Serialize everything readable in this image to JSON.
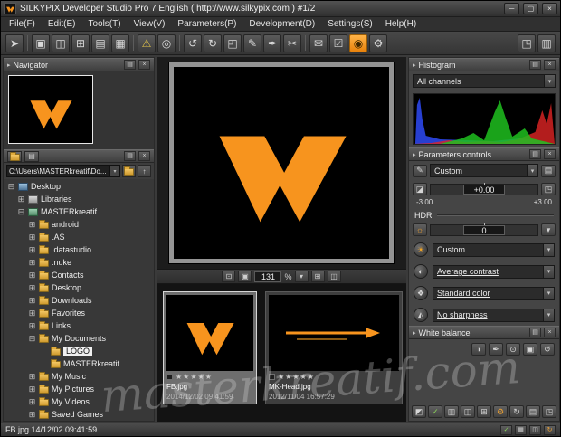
{
  "window": {
    "title": "SILKYPIX Developer Studio Pro 7 English ( http://www.silkypix.com )   #1/2",
    "minimize_glyph": "─",
    "maximize_glyph": "▢",
    "close_glyph": "×"
  },
  "ui": {
    "chevron_down": "▾"
  },
  "panel": {
    "arrow": "▸",
    "menu_glyph": "▤",
    "close_glyph": "×"
  },
  "menubar": {
    "items": [
      "File(F)",
      "Edit(E)",
      "Tools(T)",
      "View(V)",
      "Parameters(P)",
      "Development(D)",
      "Settings(S)",
      "Help(H)"
    ]
  },
  "toolbar": {
    "icons": [
      {
        "name": "select-arrow-icon",
        "glyph": "➤"
      },
      {
        "name": "single-preview-icon",
        "glyph": "▣"
      },
      {
        "name": "two-up-view-icon",
        "glyph": "◫"
      },
      {
        "name": "quad-view-icon",
        "glyph": "⊞"
      },
      {
        "name": "thumbnail-view-icon",
        "glyph": "▤"
      },
      {
        "name": "grid-view-icon",
        "glyph": "▦"
      },
      {
        "name": "warning-display-icon",
        "glyph": "⚠"
      },
      {
        "name": "loupe-icon",
        "glyph": "◎"
      },
      {
        "name": "rotate-left-icon",
        "glyph": "↺"
      },
      {
        "name": "rotate-right-icon",
        "glyph": "↻"
      },
      {
        "name": "crop-icon",
        "glyph": "◰"
      },
      {
        "name": "retouch-pen-icon",
        "glyph": "✎"
      },
      {
        "name": "dropper-icon",
        "glyph": "✒"
      },
      {
        "name": "scissors-icon",
        "glyph": "✂"
      },
      {
        "name": "send-mail-icon",
        "glyph": "✉"
      },
      {
        "name": "develop-check-icon",
        "glyph": "☑"
      },
      {
        "name": "develop-accent-icon",
        "glyph": "◉"
      },
      {
        "name": "settings-gear-icon",
        "glyph": "⚙"
      },
      {
        "name": "expand-view-icon",
        "glyph": "◳"
      },
      {
        "name": "panel-layout-icon",
        "glyph": "▥"
      }
    ]
  },
  "navigator": {
    "title": "Navigator"
  },
  "browser": {
    "path": "C:\\Users\\MASTERkreatif\\Do...",
    "up_glyph": "↑"
  },
  "tree": {
    "items": [
      {
        "exp": "⊟",
        "label": "Desktop"
      },
      {
        "exp": "⊞",
        "label": "Libraries"
      },
      {
        "exp": "⊟",
        "label": "MASTERkreatif"
      },
      {
        "exp": "⊞",
        "label": "android"
      },
      {
        "exp": "⊞",
        "label": ".AS"
      },
      {
        "exp": "⊞",
        "label": ".datastudio"
      },
      {
        "exp": "⊞",
        "label": ".nuke"
      },
      {
        "exp": "⊞",
        "label": "Contacts"
      },
      {
        "exp": "⊞",
        "label": "Desktop"
      },
      {
        "exp": "⊞",
        "label": "Downloads"
      },
      {
        "exp": "⊞",
        "label": "Favorites"
      },
      {
        "exp": "⊞",
        "label": "Links"
      },
      {
        "exp": "⊟",
        "label": "My Documents"
      },
      {
        "exp": "",
        "label": "LOGO"
      },
      {
        "exp": "",
        "label": "MASTERkreatif"
      },
      {
        "exp": "⊞",
        "label": "My Music"
      },
      {
        "exp": "⊞",
        "label": "My Pictures"
      },
      {
        "exp": "⊞",
        "label": "My Videos"
      },
      {
        "exp": "⊞",
        "label": "Saved Games"
      }
    ]
  },
  "zoom": {
    "fit_glyph": "⊡",
    "actual_glyph": "▣",
    "value": "131",
    "percent": "%",
    "grid_glyph": "⊞",
    "panes_glyph": "◫"
  },
  "thumbnails": {
    "items": [
      {
        "stars": "★★★★★",
        "name": "FB.jpg",
        "date": "2014/12/02 09:41:59"
      },
      {
        "stars": "★★★★★",
        "name": "MK-Head.jpg",
        "date": "2012/11/04 16:57:29"
      }
    ]
  },
  "histogram": {
    "title": "Histogram",
    "channel": "All channels"
  },
  "params": {
    "title": "Parameters controls",
    "preset_label": "Custom",
    "pen_glyph": "✎",
    "exposure_icon_glyph": "◪",
    "exposure_value": "+0.00",
    "scale_min": "-3.00",
    "scale_max": "+3.00",
    "plus_glyph": "⊞",
    "fine_glyph": "◳",
    "hdr_label": "HDR",
    "hdr_icon_glyph": "☼",
    "hdr_value": "0",
    "tastes": [
      {
        "name": "taste-preset-icon",
        "glyph": "☀",
        "label": "Custom"
      },
      {
        "name": "contrast-icon",
        "glyph": "◐",
        "label": "Average contrast"
      },
      {
        "name": "color-icon",
        "glyph": "❖",
        "label": "Standard color"
      },
      {
        "name": "sharpness-icon",
        "glyph": "◭",
        "label": "No sharpness"
      }
    ]
  },
  "white_balance": {
    "title": "White balance",
    "icons": [
      {
        "name": "wb-auto-icon",
        "glyph": "◑"
      },
      {
        "name": "wb-dropper-icon",
        "glyph": "✒"
      },
      {
        "name": "wb-gray-point-icon",
        "glyph": "⊙"
      },
      {
        "name": "wb-settings-icon",
        "glyph": "▣"
      },
      {
        "name": "wb-reset-icon",
        "glyph": "↺"
      }
    ]
  },
  "utility": {
    "icons": [
      {
        "name": "levels-icon",
        "glyph": "◩"
      },
      {
        "name": "confirm-icon",
        "glyph": "✓"
      },
      {
        "name": "grid-small-icon",
        "glyph": "▥"
      },
      {
        "name": "panes-icon",
        "glyph": "◫"
      },
      {
        "name": "add-grid-icon",
        "glyph": "⊞"
      },
      {
        "name": "wrench-icon",
        "glyph": "⚙"
      },
      {
        "name": "refresh-icon",
        "glyph": "↻"
      },
      {
        "name": "list-icon",
        "glyph": "▤"
      },
      {
        "name": "expand-icon",
        "glyph": "◳"
      }
    ]
  },
  "statusbar": {
    "text": "FB.jpg 14/12/02 09:41:59",
    "icons": [
      {
        "name": "status-check-icon",
        "glyph": "✓"
      },
      {
        "name": "status-grid-icon",
        "glyph": "▦"
      },
      {
        "name": "status-panes-icon",
        "glyph": "◫"
      },
      {
        "name": "status-refresh-icon",
        "glyph": "↻"
      }
    ]
  },
  "watermark": {
    "text": "masterkreatif.com"
  }
}
